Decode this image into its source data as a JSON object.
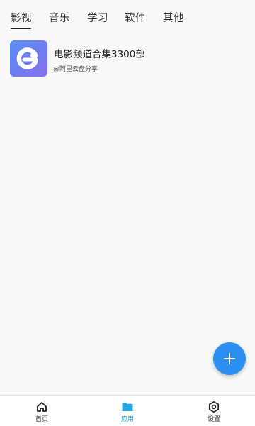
{
  "tabs": {
    "items": [
      {
        "label": "影视"
      },
      {
        "label": "音乐"
      },
      {
        "label": "学习"
      },
      {
        "label": "软件"
      },
      {
        "label": "其他"
      }
    ],
    "active_index": 0
  },
  "list": {
    "items": [
      {
        "title": "电影频道合集3300部",
        "subtitle": "@阿里云盘分享",
        "icon": "aliyun-drive-logo-icon"
      }
    ]
  },
  "fab": {
    "icon": "plus-icon"
  },
  "bottom_nav": {
    "items": [
      {
        "label": "首页",
        "icon": "home-icon",
        "active": false
      },
      {
        "label": "应用",
        "icon": "folder-icon",
        "active": true
      },
      {
        "label": "设置",
        "icon": "settings-icon",
        "active": false
      }
    ]
  },
  "colors": {
    "accent": "#25a6e0",
    "fab": "#2d8ef1",
    "background": "#f8f8f8",
    "icon_gradient_start": "#5b8ff4",
    "icon_gradient_end": "#8a6fee"
  }
}
